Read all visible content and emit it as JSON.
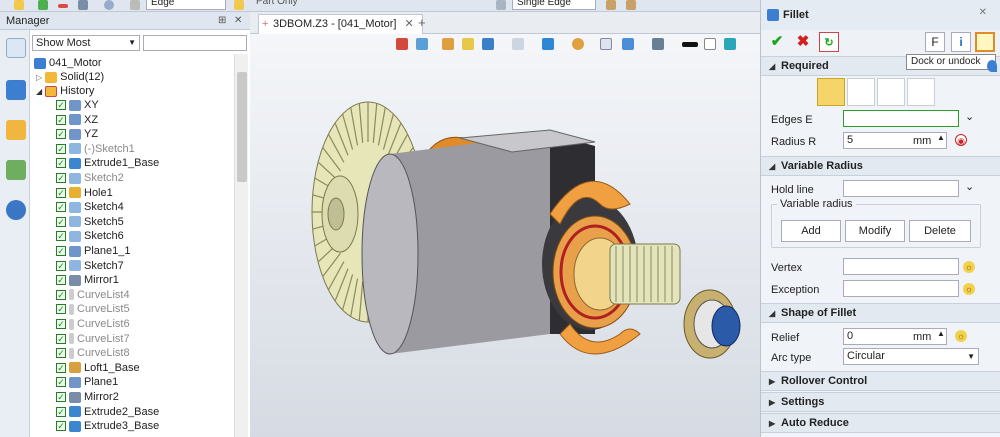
{
  "toolbar": {
    "filter_mode": "Edge",
    "scope": "Part Only",
    "pick_mode": "Single Edge"
  },
  "manager": {
    "title": "Manager",
    "filter": "Show Most"
  },
  "tree": {
    "root": "041_Motor",
    "solid": "Solid(12)",
    "history": "History",
    "items": [
      {
        "label": "XY",
        "icon": "plane-icon",
        "gray": false
      },
      {
        "label": "XZ",
        "icon": "plane-icon",
        "gray": false
      },
      {
        "label": "YZ",
        "icon": "plane-icon",
        "gray": false
      },
      {
        "label": "(-)Sketch1",
        "icon": "sketch-icon",
        "gray": true
      },
      {
        "label": "Extrude1_Base",
        "icon": "extrude-icon",
        "gray": false
      },
      {
        "label": "Sketch2",
        "icon": "sketch-icon",
        "gray": true
      },
      {
        "label": "Hole1",
        "icon": "hole-icon",
        "gray": false
      },
      {
        "label": "Sketch4",
        "icon": "sketch-icon",
        "gray": false
      },
      {
        "label": "Sketch5",
        "icon": "sketch-icon",
        "gray": false
      },
      {
        "label": "Sketch6",
        "icon": "sketch-icon",
        "gray": false
      },
      {
        "label": "Plane1_1",
        "icon": "plane-icon",
        "gray": false
      },
      {
        "label": "Sketch7",
        "icon": "sketch-icon",
        "gray": false
      },
      {
        "label": "Mirror1",
        "icon": "mirror-icon",
        "gray": false
      },
      {
        "label": "CurveList4",
        "icon": "curve-icon",
        "gray": true
      },
      {
        "label": "CurveList5",
        "icon": "curve-icon",
        "gray": true
      },
      {
        "label": "CurveList6",
        "icon": "curve-icon",
        "gray": true
      },
      {
        "label": "CurveList7",
        "icon": "curve-icon",
        "gray": true
      },
      {
        "label": "CurveList8",
        "icon": "curve-icon",
        "gray": true
      },
      {
        "label": "Loft1_Base",
        "icon": "loft-icon",
        "gray": false
      },
      {
        "label": "Plane1",
        "icon": "plane-icon",
        "gray": false
      },
      {
        "label": "Mirror2",
        "icon": "mirror-icon",
        "gray": false
      },
      {
        "label": "Extrude2_Base",
        "icon": "extrude-icon",
        "gray": false
      },
      {
        "label": "Extrude3_Base",
        "icon": "extrude-icon",
        "gray": false
      }
    ]
  },
  "tab": {
    "label": "3DBOM.Z3 - [041_Motor]"
  },
  "fillet": {
    "title": "Fillet",
    "f_label": "F",
    "tooltip": "Dock or undock",
    "required": "Required",
    "edges_label": "Edges E",
    "edges_value": "",
    "radius_label": "Radius R",
    "radius_value": "5",
    "radius_unit": "mm",
    "variable_radius": "Variable Radius",
    "hold_line": "Hold line",
    "variable_radius_group": "Variable radius",
    "add": "Add",
    "modify": "Modify",
    "delete": "Delete",
    "vertex": "Vertex",
    "exception": "Exception",
    "shape_of_fillet": "Shape of Fillet",
    "relief_label": "Relief",
    "relief_value": "0",
    "relief_unit": "mm",
    "arc_type_label": "Arc type",
    "arc_type_value": "Circular",
    "rollover": "Rollover Control",
    "settings": "Settings",
    "auto_reduce": "Auto Reduce"
  },
  "colors": {
    "accent": "#1b6ec2",
    "check_green": "#19a819",
    "cancel_red": "#d22020",
    "motor_gear": "#e6e6b8",
    "motor_copper": "#e08a2a",
    "motor_shaft_blue": "#2a5aa8"
  }
}
